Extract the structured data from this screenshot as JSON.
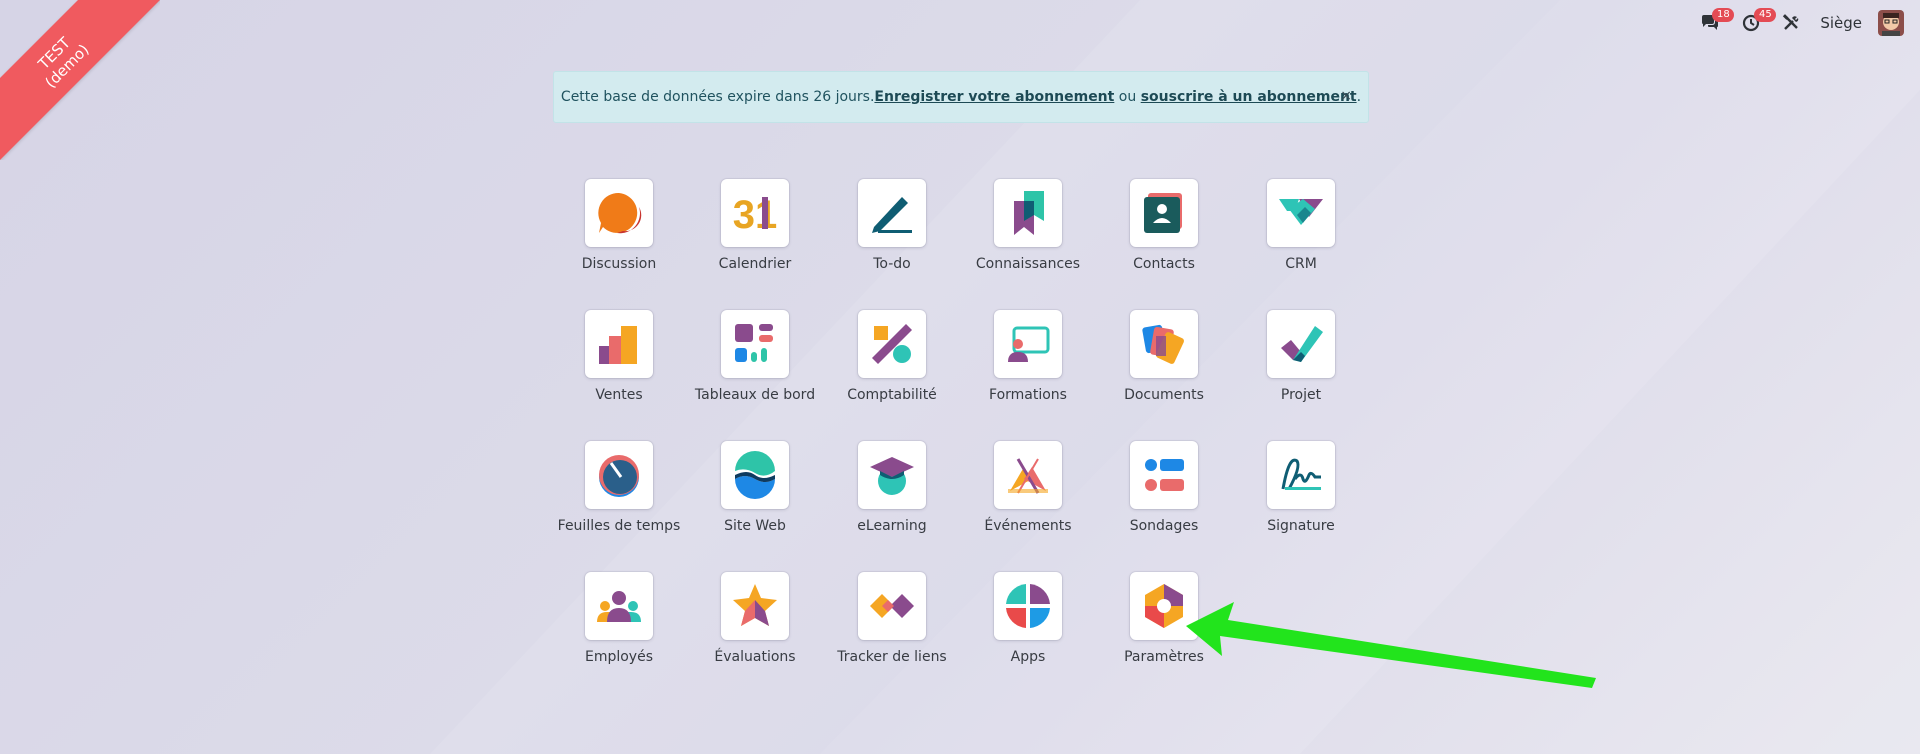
{
  "ribbon": {
    "line1": "TEST",
    "line2": "(demo)"
  },
  "topbar": {
    "messages_count": "18",
    "activities_count": "45",
    "company": "Siège"
  },
  "alert": {
    "text_before": "Cette base de données expire dans 26 jours.",
    "register_link": "Enregistrer votre abonnement",
    "middle": " ou ",
    "subscribe_link": "souscrire à un abonnement",
    "text_after": ".",
    "close": "×"
  },
  "apps": [
    {
      "label": "Discussion",
      "icon": "discussion-icon"
    },
    {
      "label": "Calendrier",
      "icon": "calendar-icon",
      "icon_text": "31"
    },
    {
      "label": "To-do",
      "icon": "todo-icon"
    },
    {
      "label": "Connaissances",
      "icon": "knowledge-icon"
    },
    {
      "label": "Contacts",
      "icon": "contacts-icon"
    },
    {
      "label": "CRM",
      "icon": "crm-icon"
    },
    {
      "label": "Ventes",
      "icon": "sales-icon"
    },
    {
      "label": "Tableaux de bord",
      "icon": "dashboards-icon"
    },
    {
      "label": "Comptabilité",
      "icon": "accounting-icon"
    },
    {
      "label": "Formations",
      "icon": "trainings-icon"
    },
    {
      "label": "Documents",
      "icon": "documents-icon"
    },
    {
      "label": "Projet",
      "icon": "project-icon"
    },
    {
      "label": "Feuilles de temps",
      "icon": "timesheets-icon"
    },
    {
      "label": "Site Web",
      "icon": "website-icon"
    },
    {
      "label": "eLearning",
      "icon": "elearning-icon"
    },
    {
      "label": "Événements",
      "icon": "events-icon"
    },
    {
      "label": "Sondages",
      "icon": "surveys-icon"
    },
    {
      "label": "Signature",
      "icon": "signature-icon"
    },
    {
      "label": "Employés",
      "icon": "employees-icon"
    },
    {
      "label": "Évaluations",
      "icon": "appraisals-icon"
    },
    {
      "label": "Tracker de liens",
      "icon": "link-tracker-icon"
    },
    {
      "label": "Apps",
      "icon": "apps-icon"
    },
    {
      "label": "Paramètres",
      "icon": "settings-icon"
    }
  ],
  "colors": {
    "ribbon": "#f05a5f",
    "alert_bg": "#d3ebef",
    "badge": "#e44b54",
    "arrow": "#1ee51a"
  }
}
